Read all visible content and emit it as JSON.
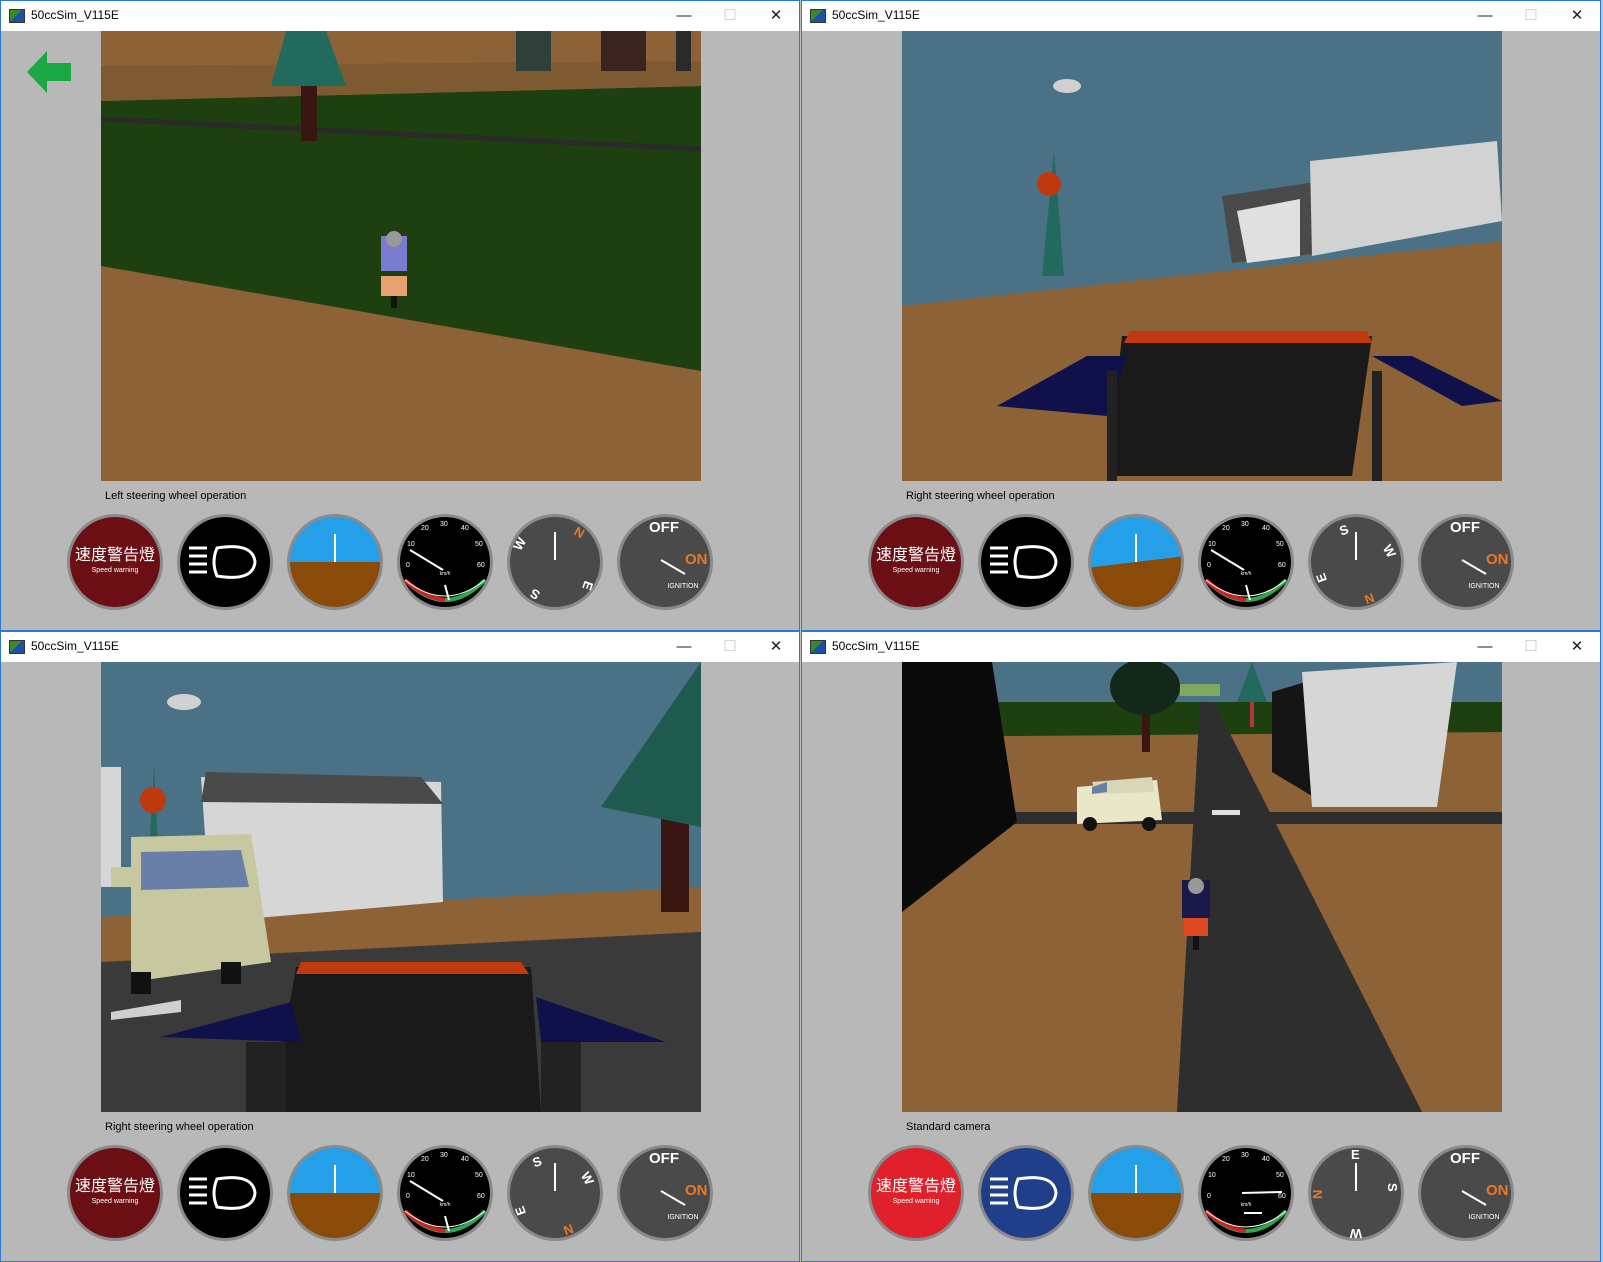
{
  "windows": [
    {
      "title": "50ccSim_V115E",
      "controls": {
        "minimize": "—",
        "maximize": "☐",
        "close": "✕"
      },
      "caption": "Left steering wheel operation",
      "has_back_arrow": true,
      "gauges": {
        "speed_warning": {
          "jp": "速度警告燈",
          "en": "Speed warning",
          "active": false
        },
        "headlight": {
          "active": false
        },
        "attitude": {
          "bank": "level"
        },
        "speedometer": {
          "ticks": [
            "0",
            "10",
            "20",
            "30",
            "40",
            "50",
            "60"
          ],
          "unit": "km/h"
        },
        "compass": {
          "letters": [
            "N",
            "E",
            "S",
            "W"
          ]
        },
        "ignition": {
          "off": "OFF",
          "on": "ON",
          "label": "IGNITION"
        }
      }
    },
    {
      "title": "50ccSim_V115E",
      "controls": {
        "minimize": "—",
        "maximize": "☐",
        "close": "✕"
      },
      "caption": "Right steering wheel operation",
      "has_back_arrow": false,
      "gauges": {
        "speed_warning": {
          "jp": "速度警告燈",
          "en": "Speed warning",
          "active": false
        },
        "headlight": {
          "active": false
        },
        "attitude": {
          "bank": "tilted"
        },
        "speedometer": {
          "ticks": [
            "0",
            "10",
            "20",
            "30",
            "40",
            "50",
            "60"
          ],
          "unit": "km/h"
        },
        "compass": {
          "letters": [
            "S",
            "W",
            "N",
            "E"
          ]
        },
        "ignition": {
          "off": "OFF",
          "on": "ON",
          "label": "IGNITION"
        }
      }
    },
    {
      "title": "50ccSim_V115E",
      "controls": {
        "minimize": "—",
        "maximize": "☐",
        "close": "✕"
      },
      "caption": "Right steering wheel operation",
      "has_back_arrow": false,
      "gauges": {
        "speed_warning": {
          "jp": "速度警告燈",
          "en": "Speed warning",
          "active": false
        },
        "headlight": {
          "active": false
        },
        "attitude": {
          "bank": "level"
        },
        "speedometer": {
          "ticks": [
            "0",
            "10",
            "20",
            "30",
            "40",
            "50",
            "60"
          ],
          "unit": "km/h"
        },
        "compass": {
          "letters": [
            "S",
            "W",
            "N",
            "E"
          ]
        },
        "ignition": {
          "off": "OFF",
          "on": "ON",
          "label": "IGNITION"
        }
      }
    },
    {
      "title": "50ccSim_V115E",
      "controls": {
        "minimize": "—",
        "maximize": "☐",
        "close": "✕"
      },
      "caption": "Standard camera",
      "has_back_arrow": false,
      "gauges": {
        "speed_warning": {
          "jp": "速度警告燈",
          "en": "Speed warning",
          "active": true
        },
        "headlight": {
          "active": true
        },
        "attitude": {
          "bank": "level"
        },
        "speedometer": {
          "ticks": [
            "0",
            "10",
            "20",
            "30",
            "40",
            "50",
            "60"
          ],
          "unit": "km/h"
        },
        "compass": {
          "letters": [
            "E",
            "S",
            "W",
            "N"
          ]
        },
        "ignition": {
          "off": "OFF",
          "on": "ON",
          "label": "IGNITION"
        }
      }
    }
  ],
  "colors": {
    "sky": "#4a7186",
    "ground_brown": "#8c6236",
    "grass": "#1e4010",
    "road": "#2e2e2e",
    "warning_dim": "#6b0f14",
    "warning_active": "#e0202a",
    "headlight_active": "#1f3f8a",
    "attitude_sky": "#25a0e8",
    "attitude_ground": "#8a4a08",
    "accent_orange": "#e8782a",
    "back_arrow": "#19a844"
  }
}
